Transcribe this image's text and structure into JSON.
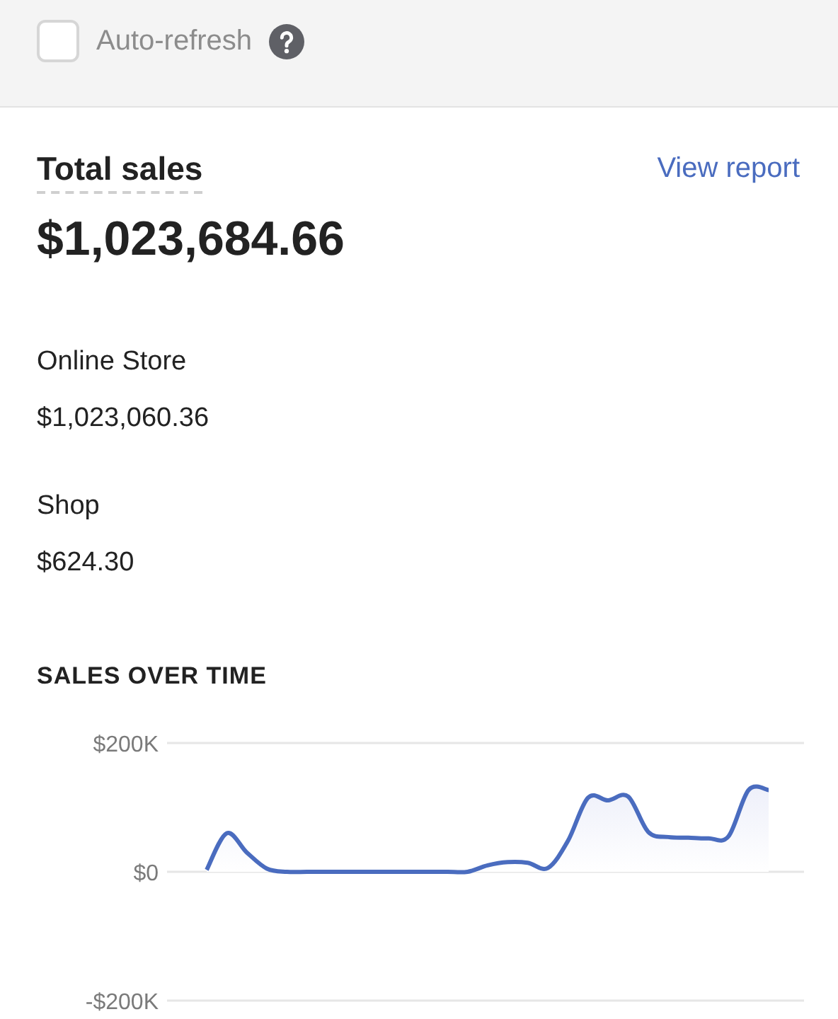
{
  "toolbar": {
    "auto_refresh": {
      "label": "Auto-refresh",
      "checked": false
    }
  },
  "summary": {
    "title": "Total sales",
    "link": "View report",
    "total": "$1,023,684.66",
    "channels": [
      {
        "name": "Online Store",
        "amount": "$1,023,060.36"
      },
      {
        "name": "Shop",
        "amount": "$624.30"
      }
    ]
  },
  "chart": {
    "title": "SALES OVER TIME",
    "chart_data": {
      "type": "area",
      "ylim": [
        -200000,
        200000
      ],
      "yticks": [
        {
          "value": 200000,
          "label": "$200K"
        },
        {
          "value": 0,
          "label": "$0"
        },
        {
          "value": -200000,
          "label": "-$200K"
        }
      ],
      "series": [
        {
          "color": "#4a6cbf",
          "values": [
            3000,
            60000,
            30000,
            5000,
            0,
            0,
            0,
            0,
            0,
            0,
            0,
            0,
            0,
            0,
            10000,
            15000,
            14000,
            6000,
            48000,
            115000,
            111000,
            117000,
            62000,
            54000,
            53000,
            52000,
            55000,
            127000,
            127000
          ]
        }
      ]
    }
  }
}
